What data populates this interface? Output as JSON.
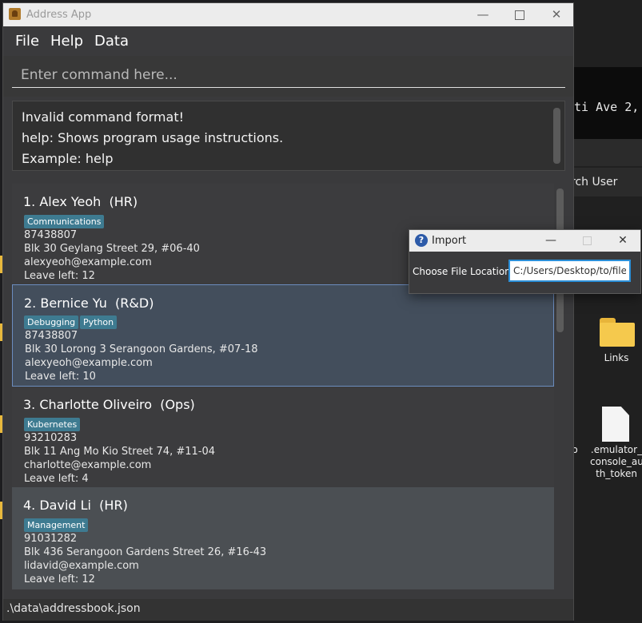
{
  "window": {
    "title": "Address App",
    "accent_color": "#6b8cbe",
    "tag_color": "#3e7b91"
  },
  "menu": {
    "items": [
      "File",
      "Help",
      "Data"
    ]
  },
  "command": {
    "placeholder": "Enter command here...",
    "value": ""
  },
  "result": {
    "lines": [
      "Invalid command format!",
      "help: Shows program usage instructions.",
      "Example: help"
    ]
  },
  "persons": [
    {
      "index": "1.",
      "name": "Alex Yeoh",
      "role": "(HR)",
      "tags": [
        "Communications"
      ],
      "phone": "87438807",
      "address": "Blk 30 Geylang Street 29, #06-40",
      "email": "alexyeoh@example.com",
      "leave": "Leave left: 12"
    },
    {
      "index": "2.",
      "name": "Bernice Yu",
      "role": "(R&D)",
      "tags": [
        "Debugging",
        "Python"
      ],
      "phone": "87438807",
      "address": "Blk 30 Lorong 3 Serangoon Gardens, #07-18",
      "email": "alexyeoh@example.com",
      "leave": "Leave left: 10"
    },
    {
      "index": "3.",
      "name": "Charlotte Oliveiro",
      "role": "(Ops)",
      "tags": [
        "Kubernetes"
      ],
      "phone": "93210283",
      "address": "Blk 11 Ang Mo Kio Street 74, #11-04",
      "email": "charlotte@example.com",
      "leave": "Leave left: 4"
    },
    {
      "index": "4.",
      "name": "David Li",
      "role": "(HR)",
      "tags": [
        "Management"
      ],
      "phone": "91031282",
      "address": "Blk 436 Serangoon Gardens Street 26, #16-43",
      "email": "lidavid@example.com",
      "leave": "Leave left: 12"
    }
  ],
  "status": {
    "path": ".\\data\\addressbook.json"
  },
  "import_dialog": {
    "title": "Import",
    "label": "Choose File Location:",
    "value": "C:/Users/Desktop/to/file.c"
  },
  "background": {
    "terminal_text": "ti Ave 2,",
    "search_text": "rch User",
    "links_label": "Links",
    "file_label": ".emulator_ console_au th_token",
    "cut_label": "o"
  }
}
